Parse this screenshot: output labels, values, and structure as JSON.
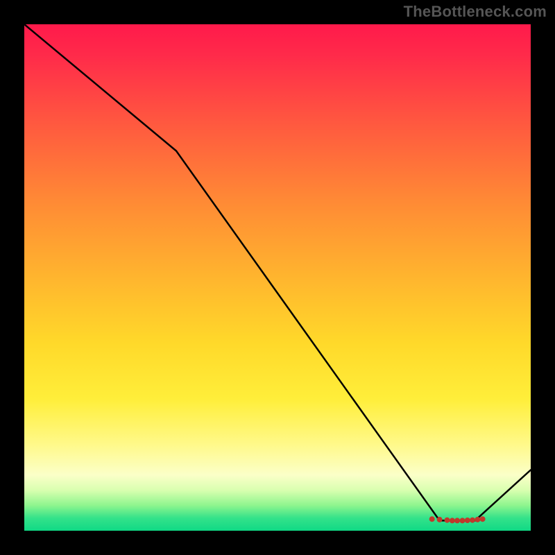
{
  "watermark": "TheBottleneck.com",
  "chart_data": {
    "type": "line",
    "title": "",
    "xlabel": "",
    "ylabel": "",
    "xlim": [
      0,
      100
    ],
    "ylim": [
      0,
      100
    ],
    "series": [
      {
        "name": "curve",
        "x": [
          0,
          30,
          82,
          89,
          100
        ],
        "values": [
          100,
          75,
          2,
          2,
          12
        ]
      }
    ],
    "markers": {
      "name": "bottom-cluster",
      "x": [
        80.5,
        82,
        83.5,
        84.5,
        85.5,
        86.5,
        87.5,
        88.5,
        89.5,
        90.5
      ],
      "values": [
        2.3,
        2.2,
        2.1,
        2.0,
        2.0,
        2.0,
        2.05,
        2.1,
        2.2,
        2.3
      ],
      "color": "#c0392b",
      "radius_px": 4
    },
    "gradient_stops": [
      {
        "pos": 0,
        "color": "#ff1a4b"
      },
      {
        "pos": 0.5,
        "color": "#ffb52e"
      },
      {
        "pos": 0.83,
        "color": "#fff98a"
      },
      {
        "pos": 1.0,
        "color": "#10d985"
      }
    ]
  }
}
